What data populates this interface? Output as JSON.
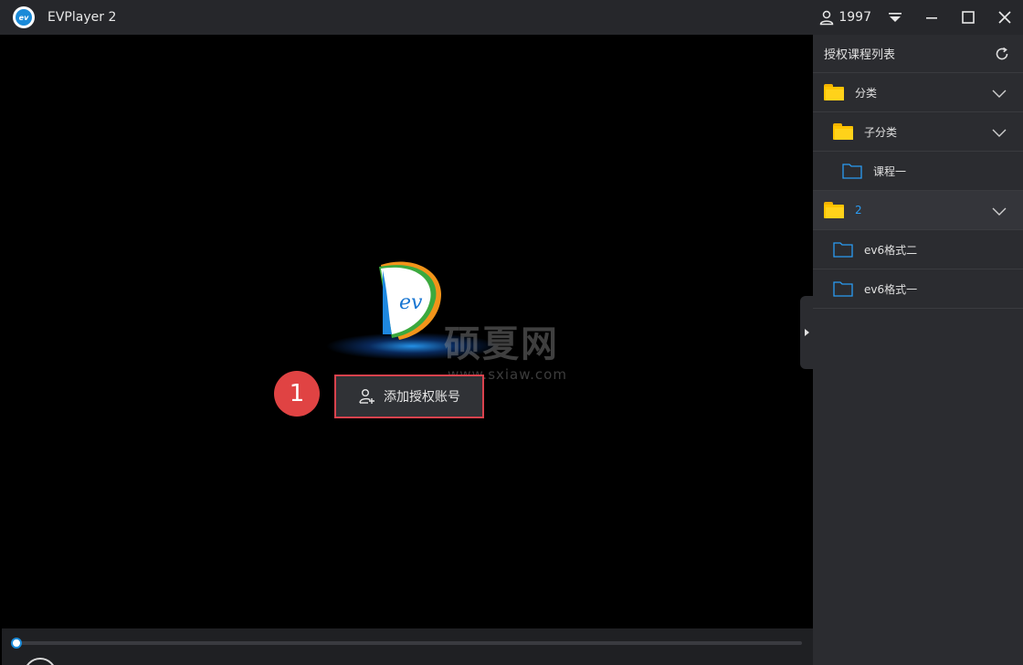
{
  "window": {
    "title": "EVPlayer 2",
    "logo_text": "ev",
    "user_name": "1997"
  },
  "player": {
    "logo_text": "ev",
    "watermark": "硕夏网",
    "watermark_url": "www.sxiaw.com",
    "step_number": "1",
    "add_account_label": "添加授权账号",
    "progress": 0.0
  },
  "sidebar": {
    "title": "授权课程列表",
    "items": [
      {
        "label": "分类",
        "type": "folder-filled",
        "indent": 0,
        "expandable": true,
        "accent": false
      },
      {
        "label": "子分类",
        "type": "folder-filled",
        "indent": 1,
        "expandable": true,
        "accent": false
      },
      {
        "label": "课程一",
        "type": "folder-outline",
        "indent": 2,
        "expandable": false,
        "accent": false
      },
      {
        "label": "2",
        "type": "folder-filled",
        "indent": 0,
        "expandable": true,
        "accent": true
      },
      {
        "label": "ev6格式二",
        "type": "folder-outline",
        "indent": 1,
        "expandable": false,
        "accent": false
      },
      {
        "label": "ev6格式一",
        "type": "folder-outline",
        "indent": 1,
        "expandable": false,
        "accent": false
      }
    ]
  },
  "colors": {
    "accent": "#1a8ad8",
    "highlight_border": "#d9424d",
    "badge": "#e04343",
    "folder": "#ffc400"
  },
  "icons": [
    "user-icon",
    "menu-dropdown-icon",
    "minimize-icon",
    "maximize-icon",
    "close-icon",
    "refresh-icon",
    "add-user-icon",
    "chevron-down-icon",
    "folder-icon",
    "folder-outline-icon"
  ]
}
